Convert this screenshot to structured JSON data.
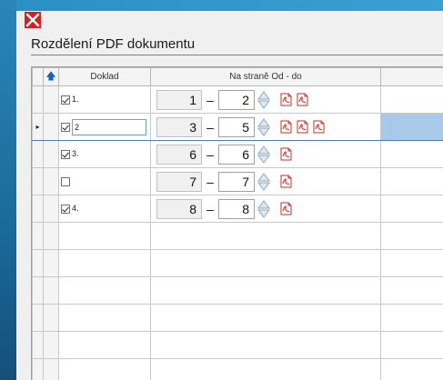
{
  "window": {
    "title": "Rozdělení PDF dokumentu"
  },
  "grid": {
    "columns": {
      "doc": "Doklad",
      "pages": "Na straně Od - do"
    },
    "dash": "–",
    "rows": [
      {
        "checked": true,
        "doc": "1.",
        "from": "1",
        "to": "2",
        "pdf_count": 2,
        "selected": false
      },
      {
        "checked": true,
        "doc": "2",
        "from": "3",
        "to": "5",
        "pdf_count": 3,
        "selected": true
      },
      {
        "checked": true,
        "doc": "3.",
        "from": "6",
        "to": "6",
        "pdf_count": 1,
        "selected": false
      },
      {
        "checked": false,
        "doc": "",
        "from": "7",
        "to": "7",
        "pdf_count": 1,
        "selected": false
      },
      {
        "checked": true,
        "doc": "4.",
        "from": "8",
        "to": "8",
        "pdf_count": 1,
        "selected": false
      }
    ],
    "empty_rows": 6
  },
  "colors": {
    "close": "#d42020",
    "selection": "#a9c9eb",
    "pdf_red": "#d93a2e"
  },
  "icons": {
    "close": "close-icon",
    "sort": "sort-up-arrow-icon",
    "spinner": "spinner-icon",
    "pdf": "pdf-file-icon",
    "current_row": "row-pointer-icon"
  }
}
